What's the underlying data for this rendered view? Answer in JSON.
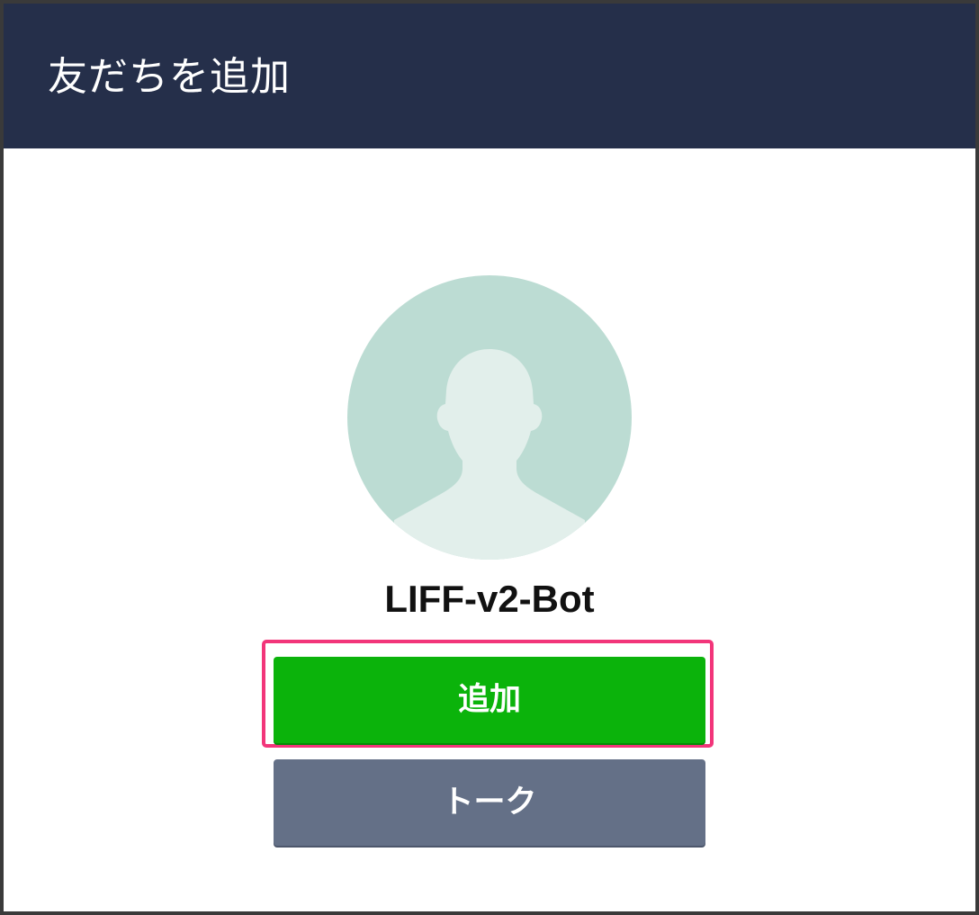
{
  "header": {
    "title": "友だちを追加"
  },
  "profile": {
    "name": "LIFF-v2-Bot",
    "avatar_icon": "default-person-avatar-icon"
  },
  "actions": {
    "add_label": "追加",
    "talk_label": "トーク"
  },
  "colors": {
    "header_bg": "#252f4a",
    "add_button": "#0bb30b",
    "talk_button": "#647087",
    "highlight_border": "#f2357a",
    "avatar_bg": "#bcdcd3",
    "avatar_silhouette": "#e2efeb"
  }
}
